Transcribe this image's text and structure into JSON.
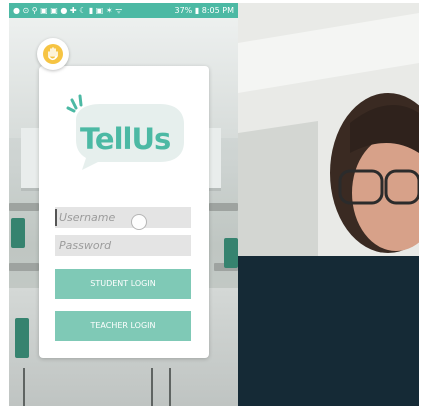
{
  "status_bar": {
    "left_icons": "● ⊙ ⚲ ▣ ▣ ● ✚ ☾ ▮ ▣ ✶ ᯤ",
    "battery": "37%",
    "time": "8:05 PM"
  },
  "login": {
    "username_placeholder": "Username",
    "password_placeholder": "Password",
    "student_button": "STUDENT LOGIN",
    "teacher_button": "TEACHER LOGIN"
  },
  "logo": {
    "text": "TellUs"
  },
  "colors": {
    "accent": "#4cb9a4",
    "button": "#7fc9b6",
    "dark_panel": "#152a36"
  }
}
